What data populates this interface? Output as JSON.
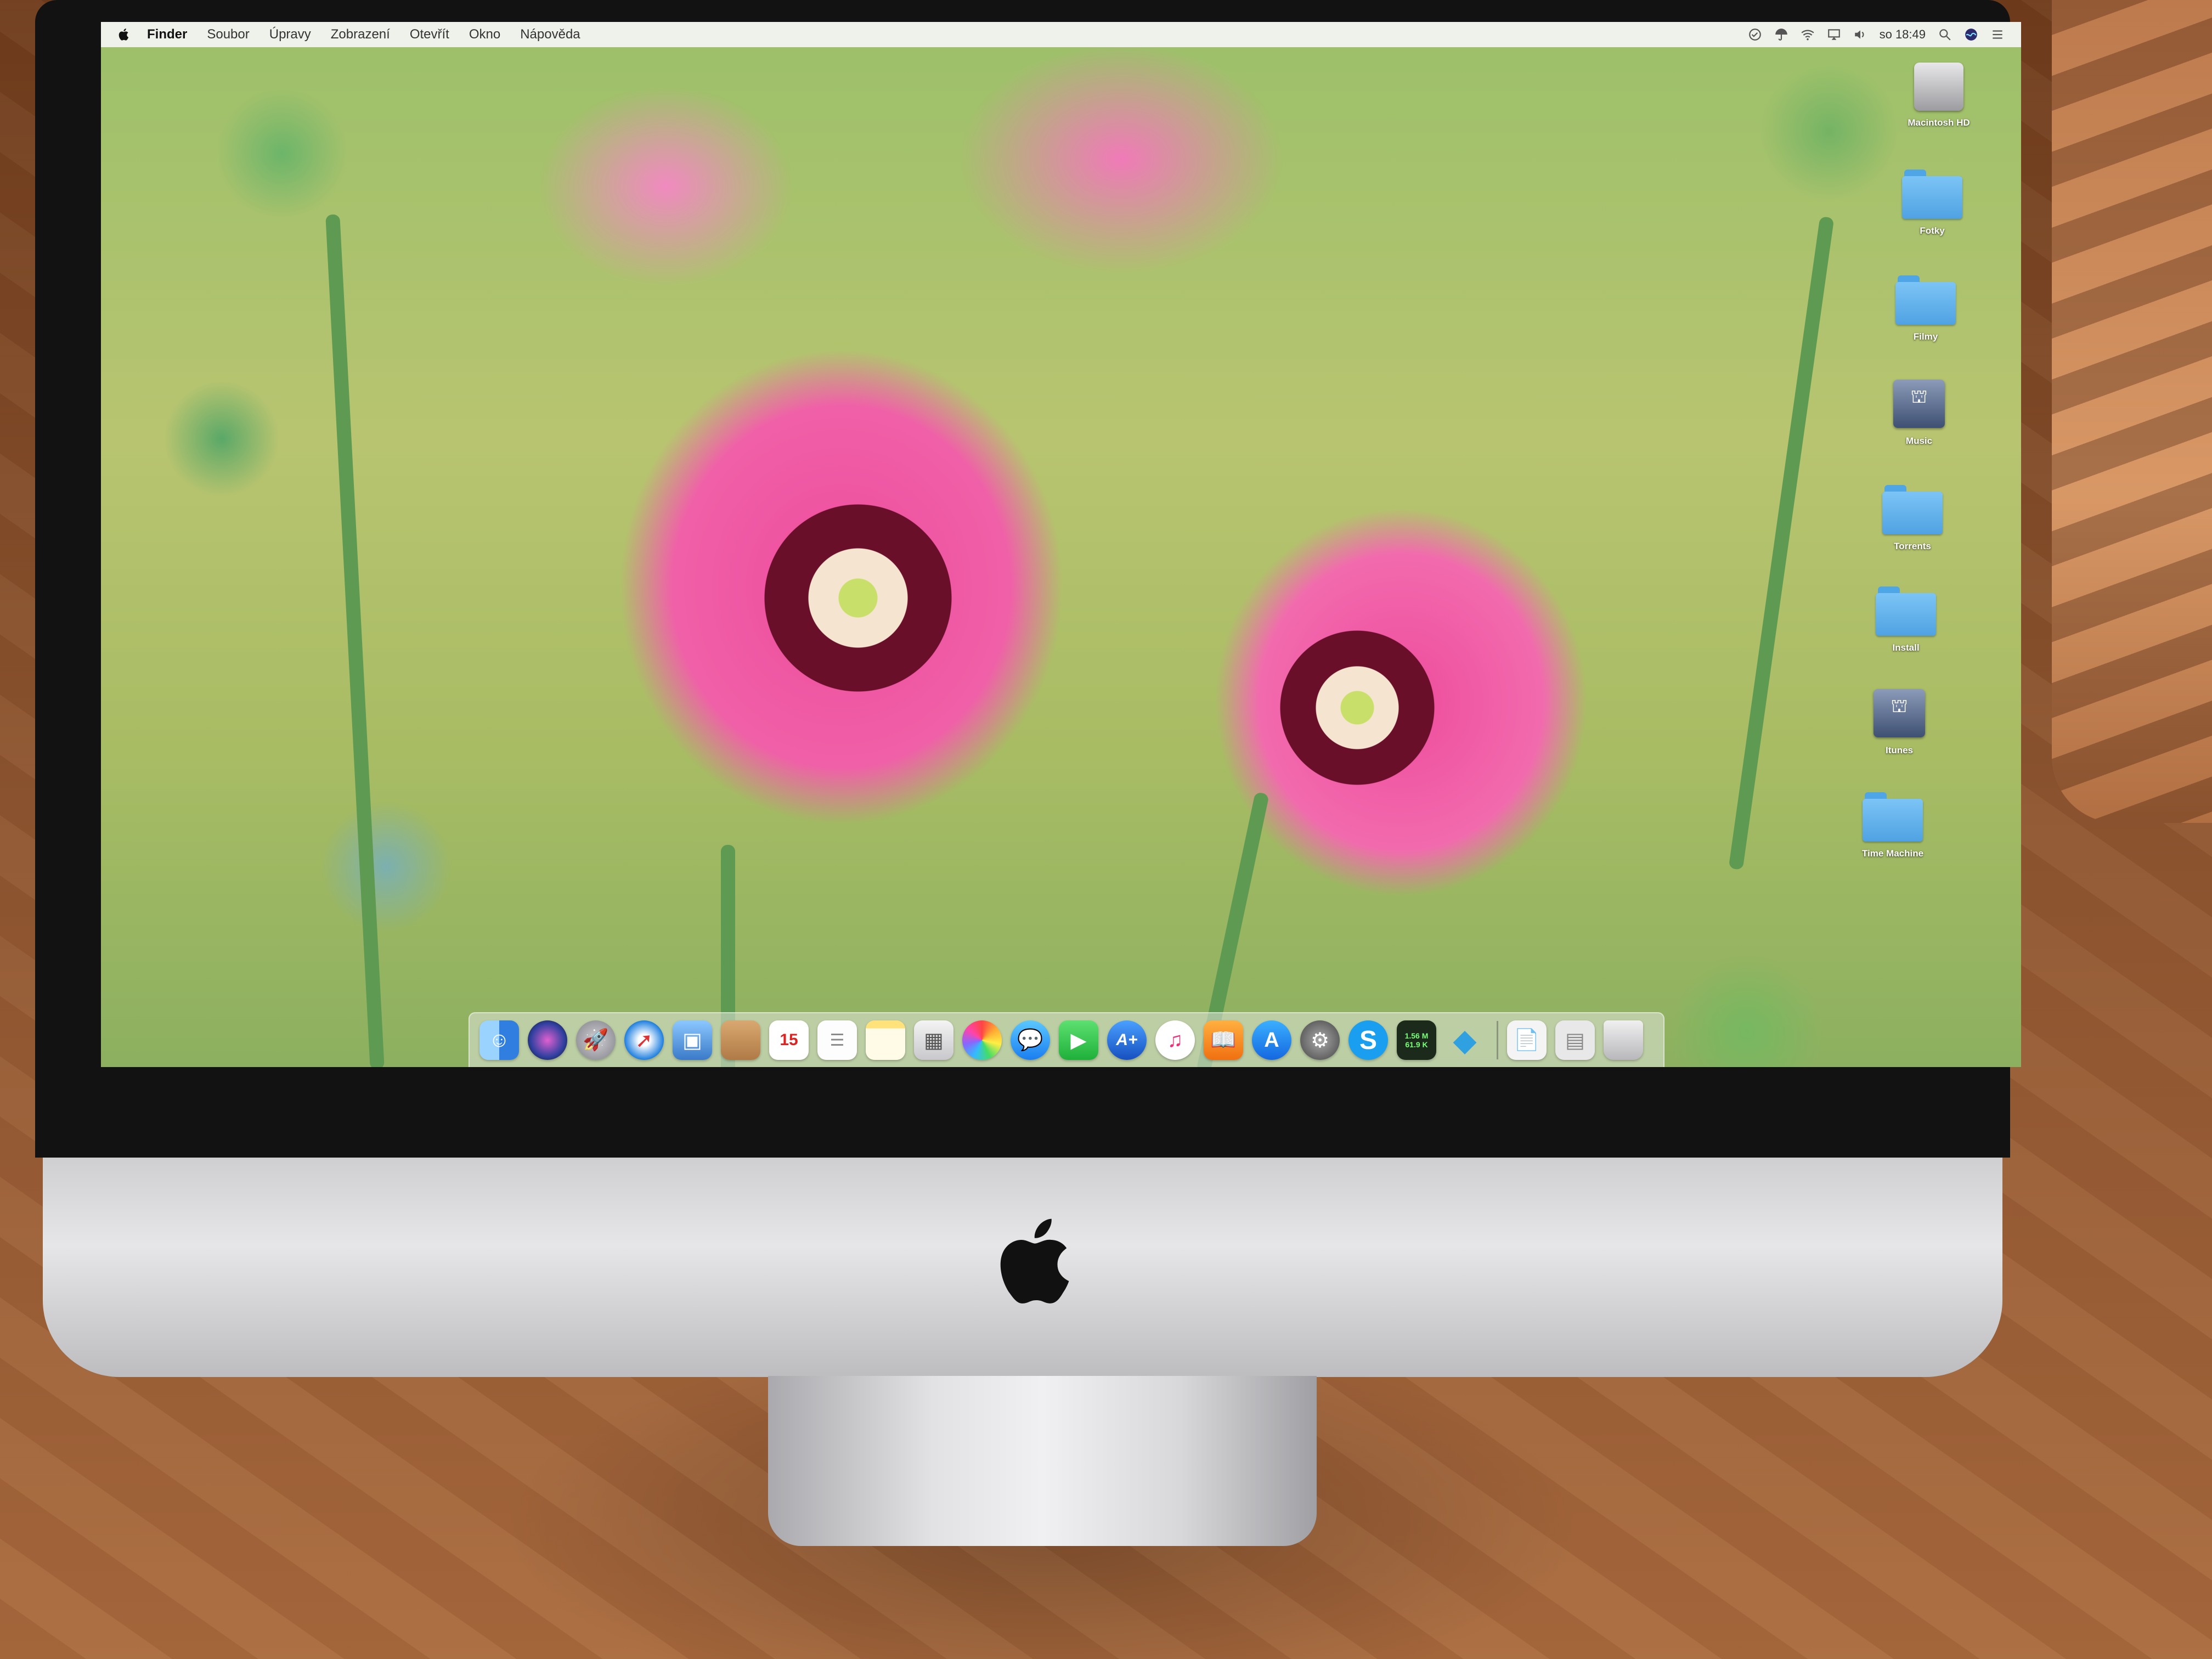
{
  "menubar": {
    "app_name": "Finder",
    "items": [
      "Soubor",
      "Úpravy",
      "Zobrazení",
      "Otevřít",
      "Okno",
      "Nápověda"
    ],
    "clock": "so 18:49"
  },
  "desktop_icons": [
    {
      "label": "Macintosh HD",
      "icon": "hard-drive-icon"
    },
    {
      "label": "Fotky",
      "icon": "folder-icon"
    },
    {
      "label": "Filmy",
      "icon": "folder-icon"
    },
    {
      "label": "Music",
      "icon": "network-volume-icon"
    },
    {
      "label": "Torrents",
      "icon": "folder-icon"
    },
    {
      "label": "Install",
      "icon": "folder-icon"
    },
    {
      "label": "Itunes",
      "icon": "network-volume-icon"
    },
    {
      "label": "Time Machine",
      "icon": "folder-icon"
    }
  ],
  "dock": {
    "calendar_day": "15",
    "network_up": "1.56 M",
    "network_down": "61.9 K",
    "apps": [
      "Finder",
      "Siri",
      "Launchpad",
      "Safari",
      "Preview",
      "Contacts",
      "Calendar",
      "Reminders",
      "Notes",
      "Photo Booth",
      "Photos",
      "Messages",
      "FaceTime",
      "Instruments",
      "iTunes",
      "iBooks",
      "App Store",
      "System Preferences",
      "Skype",
      "Network Monitor",
      "Kodi"
    ]
  }
}
